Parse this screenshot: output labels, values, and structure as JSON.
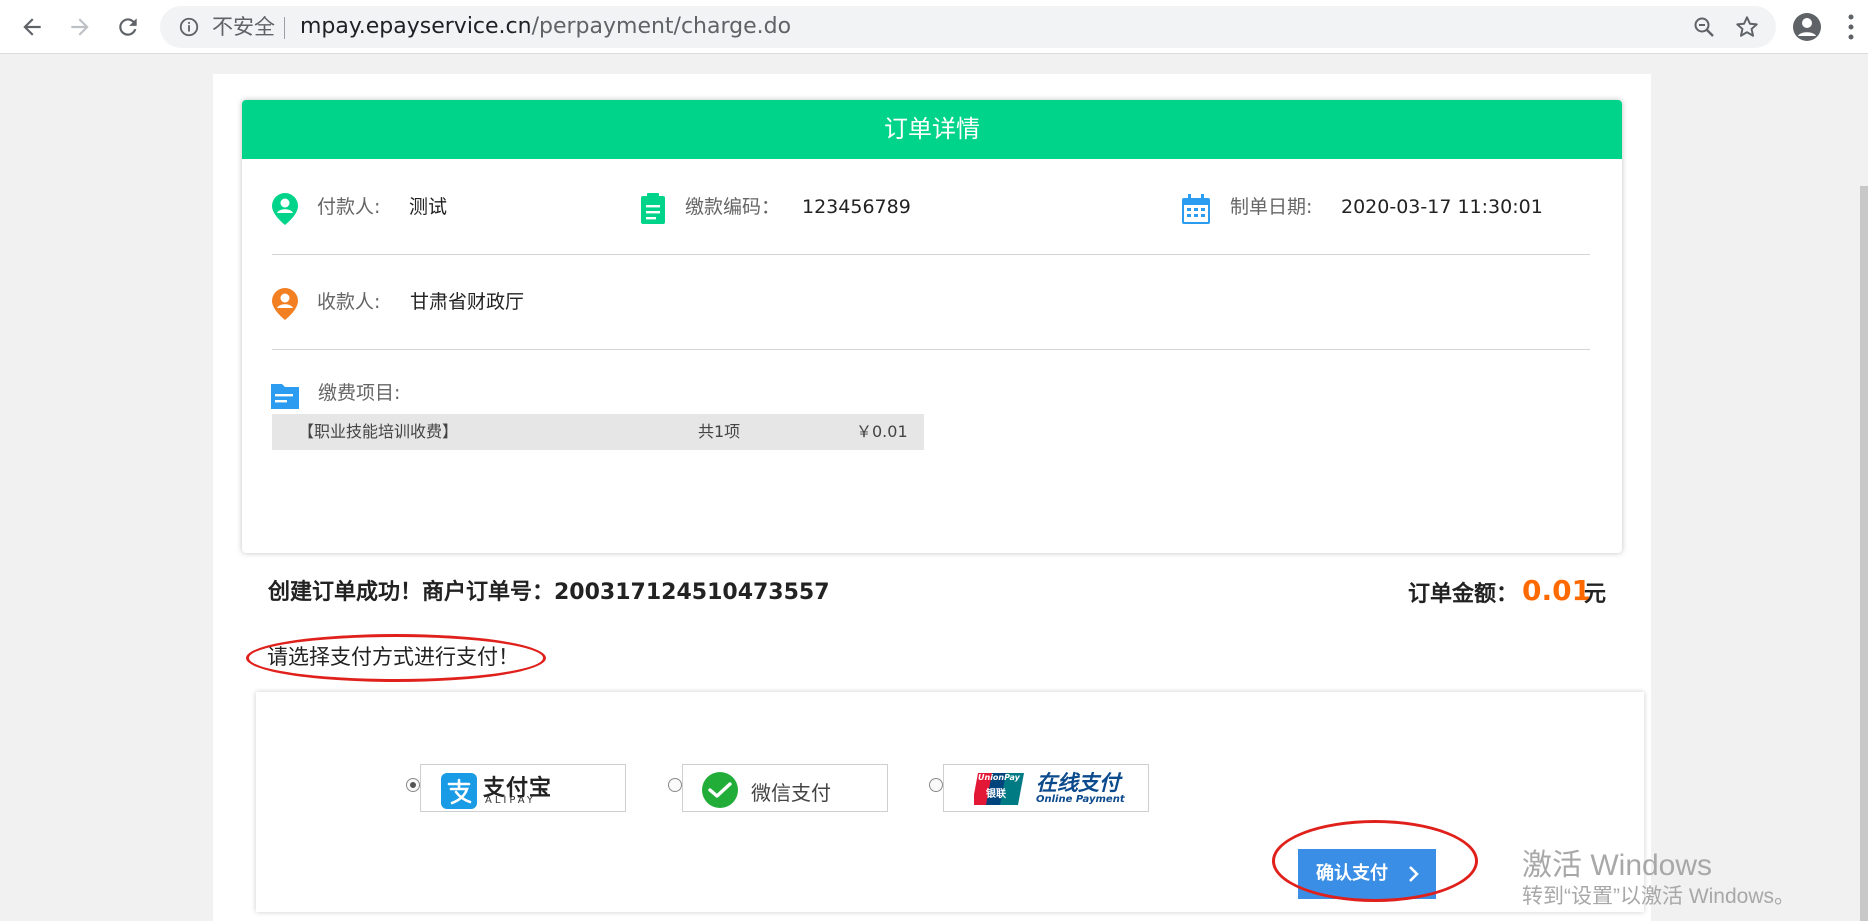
{
  "browser": {
    "insecure_label": "不安全",
    "url_host": "mpay.epayservice.cn",
    "url_path": "/perpayment/charge.do"
  },
  "card": {
    "title": "订单详情",
    "payer": {
      "label": "付款人:",
      "value": "测试"
    },
    "code": {
      "label": "缴款编码：",
      "value": "123456789"
    },
    "date": {
      "label": "制单日期:",
      "value": "2020-03-17 11:30:01"
    },
    "payee": {
      "label": "收款人:",
      "value": "甘肃省财政厅"
    },
    "items": {
      "label": "缴费项目:",
      "rows": [
        {
          "name": "【职业技能培训收费】",
          "count": "共1项",
          "price": "￥0.01"
        }
      ]
    }
  },
  "order": {
    "success_text": "创建订单成功！商户订单号：200317124510473557",
    "amount_label": "订单金额：",
    "amount_value": "0.01",
    "amount_unit": "元"
  },
  "payment": {
    "prompt": "请选择支付方式进行支付！",
    "options": [
      {
        "name": "支付宝",
        "sub": "ALIPAY",
        "selected": true
      },
      {
        "name": "微信支付",
        "selected": false
      },
      {
        "name": "在线支付",
        "sub": "Online Payment",
        "brand": "UnionPay",
        "brand_cn": "银联",
        "selected": false
      }
    ],
    "confirm_label": "确认支付"
  },
  "watermark": {
    "line1": "激活 Windows",
    "line2": "转到“设置”以激活 Windows。"
  },
  "colors": {
    "header_green": "#00d48a",
    "amount_orange": "#ff6a00",
    "button_blue": "#3a8ee6",
    "annotation_red": "#e0201b"
  }
}
